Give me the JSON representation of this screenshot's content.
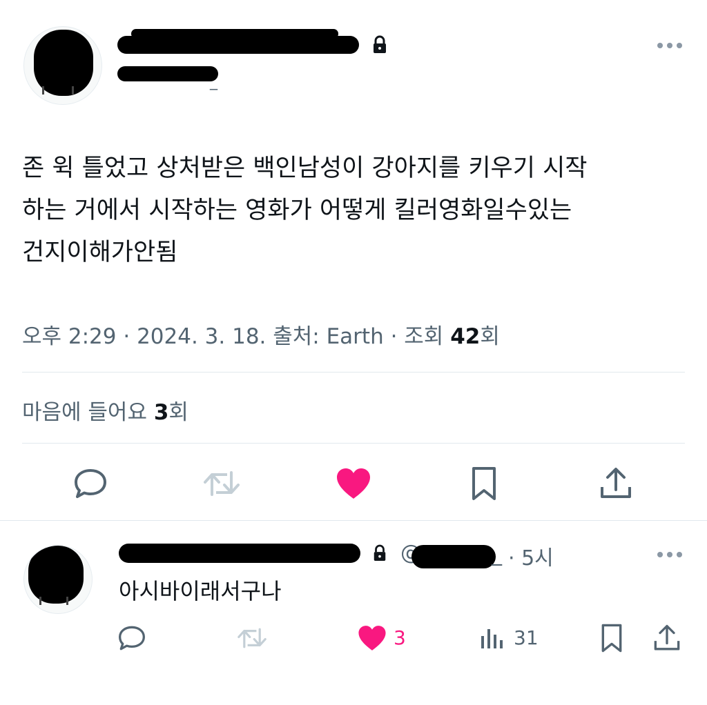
{
  "tweet": {
    "text_lines": [
      "존 윅 틀었고 상처받은 백인남성이 강아지를 키우기 시작",
      "하는 거에서 시작하는 영화가 어떻게 킬러영화일수있는",
      "건지이해가안됨"
    ],
    "meta_time": "오후 2:29 · 2024. 3. 18. 출처: Earth · 조회 ",
    "meta_views": "42",
    "meta_views_suffix": "회",
    "likes_prefix": "마음에 들어요 ",
    "likes_count": "3",
    "likes_suffix": "회",
    "handle_tail": "_"
  },
  "reply": {
    "handle_prefix": "@",
    "handle_tail": "_",
    "time": "· 5시",
    "text": "아시바이래서구나",
    "likes": "3",
    "views": "31"
  },
  "colors": {
    "like_pink": "#f91880",
    "muted": "#536471",
    "divider": "#e1e8ed"
  },
  "icons": [
    "more-icon",
    "lock-icon",
    "reply-icon",
    "retweet-icon",
    "heart-icon",
    "bookmark-icon",
    "share-icon",
    "views-icon"
  ]
}
